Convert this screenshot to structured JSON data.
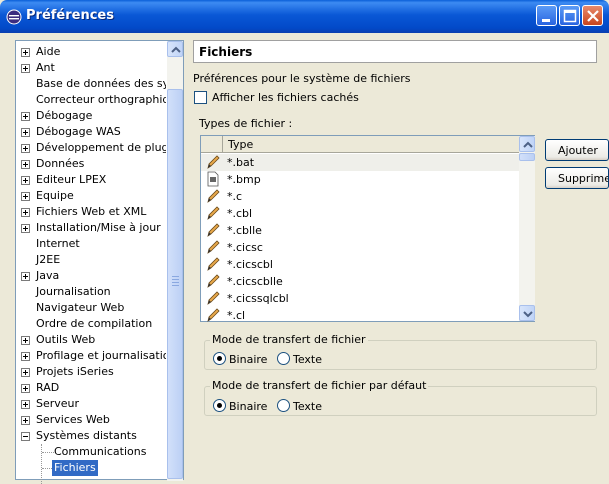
{
  "window": {
    "title": "Préférences",
    "icon": "eclipse-icon"
  },
  "sidebar": {
    "items": [
      {
        "label": "Aide",
        "expandable": true
      },
      {
        "label": "Ant",
        "expandable": true
      },
      {
        "label": "Base de données des symp",
        "expandable": false
      },
      {
        "label": "Correcteur orthographique",
        "expandable": false
      },
      {
        "label": "Débogage",
        "expandable": true
      },
      {
        "label": "Débogage WAS",
        "expandable": true
      },
      {
        "label": "Développement de plug-in",
        "expandable": true
      },
      {
        "label": "Données",
        "expandable": true
      },
      {
        "label": "Editeur LPEX",
        "expandable": true
      },
      {
        "label": "Equipe",
        "expandable": true
      },
      {
        "label": "Fichiers Web et XML",
        "expandable": true
      },
      {
        "label": "Installation/Mise à jour",
        "expandable": true
      },
      {
        "label": "Internet",
        "expandable": false
      },
      {
        "label": "J2EE",
        "expandable": false
      },
      {
        "label": "Java",
        "expandable": true
      },
      {
        "label": "Journalisation",
        "expandable": false
      },
      {
        "label": "Navigateur Web",
        "expandable": false
      },
      {
        "label": "Ordre de compilation",
        "expandable": false
      },
      {
        "label": "Outils Web",
        "expandable": true
      },
      {
        "label": "Profilage et journalisation",
        "expandable": true
      },
      {
        "label": "Projets iSeries",
        "expandable": true
      },
      {
        "label": "RAD",
        "expandable": true
      },
      {
        "label": "Serveur",
        "expandable": true
      },
      {
        "label": "Services Web",
        "expandable": true
      },
      {
        "label": "Systèmes distants",
        "expandable": true,
        "expanded": true
      }
    ],
    "children": [
      {
        "label": "Communications"
      },
      {
        "label": "Fichiers",
        "selected": true
      }
    ]
  },
  "panel": {
    "title": "Fichiers",
    "description": "Préférences pour le système de fichiers",
    "show_hidden_label": "Afficher les fichiers cachés",
    "types_label": "Types de fichier :",
    "table": {
      "header": "Type",
      "rows": [
        {
          "name": "*.bat",
          "icon": "pencil-icon"
        },
        {
          "name": "*.bmp",
          "icon": "binary-file-icon"
        },
        {
          "name": "*.c",
          "icon": "pencil-icon"
        },
        {
          "name": "*.cbl",
          "icon": "pencil-icon"
        },
        {
          "name": "*.cblle",
          "icon": "pencil-icon"
        },
        {
          "name": "*.cicsc",
          "icon": "pencil-icon"
        },
        {
          "name": "*.cicscbl",
          "icon": "pencil-icon"
        },
        {
          "name": "*.cicscblle",
          "icon": "pencil-icon"
        },
        {
          "name": "*.cicssqlcbl",
          "icon": "pencil-icon"
        },
        {
          "name": "*.cl",
          "icon": "pencil-icon"
        }
      ]
    },
    "buttons": {
      "add": "Ajouter",
      "remove": "Supprimer"
    },
    "transfer_mode": {
      "title": "Mode de transfert de fichier",
      "binary": "Binaire",
      "text": "Texte",
      "selected": "Binaire"
    },
    "default_transfer_mode": {
      "title": "Mode de transfert de fichier par défaut",
      "binary": "Binaire",
      "text": "Texte",
      "selected": "Binaire"
    }
  },
  "colors": {
    "titlebar": "#0a58d6",
    "selection": "#316ac5",
    "dialog_bg": "#ece9d8"
  }
}
